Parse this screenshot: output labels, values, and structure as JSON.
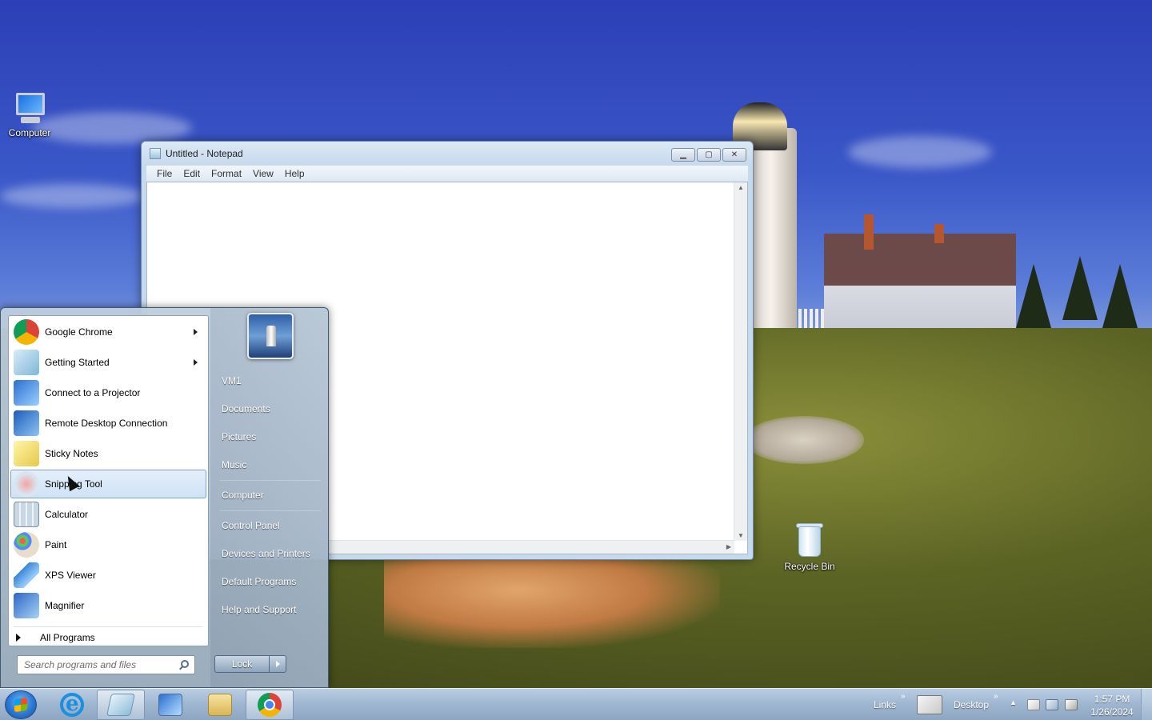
{
  "desktop": {
    "icons": [
      {
        "label": "Computer"
      },
      {
        "label": "Recycle Bin"
      }
    ]
  },
  "notepad": {
    "title": "Untitled - Notepad",
    "menu": [
      "File",
      "Edit",
      "Format",
      "View",
      "Help"
    ],
    "content": ""
  },
  "start_menu": {
    "programs": [
      {
        "label": "Google Chrome",
        "icon": "chrome-icon",
        "has_submenu": true
      },
      {
        "label": "Getting Started",
        "icon": "getting-started-icon",
        "has_submenu": true
      },
      {
        "label": "Connect to a Projector",
        "icon": "projector-icon",
        "has_submenu": false
      },
      {
        "label": "Remote Desktop Connection",
        "icon": "remote-desktop-icon",
        "has_submenu": false
      },
      {
        "label": "Sticky Notes",
        "icon": "sticky-notes-icon",
        "has_submenu": false
      },
      {
        "label": "Snipping Tool",
        "icon": "snipping-tool-icon",
        "has_submenu": false,
        "selected": true
      },
      {
        "label": "Calculator",
        "icon": "calculator-icon",
        "has_submenu": false
      },
      {
        "label": "Paint",
        "icon": "paint-icon",
        "has_submenu": false
      },
      {
        "label": "XPS Viewer",
        "icon": "xps-viewer-icon",
        "has_submenu": false
      },
      {
        "label": "Magnifier",
        "icon": "magnifier-icon",
        "has_submenu": false
      }
    ],
    "all_programs": "All Programs",
    "search_placeholder": "Search programs and files",
    "right_links": [
      "VM1",
      "Documents",
      "Pictures",
      "Music",
      "Computer",
      "Control Panel",
      "Devices and Printers",
      "Default Programs",
      "Help and Support"
    ],
    "lock_label": "Lock"
  },
  "taskbar": {
    "links_label": "Links",
    "desktop_label": "Desktop",
    "time": "1:57 PM",
    "date": "1/26/2024"
  },
  "colors": {
    "accent": "#7da2ce",
    "taskbar": "#9fb6d0"
  }
}
